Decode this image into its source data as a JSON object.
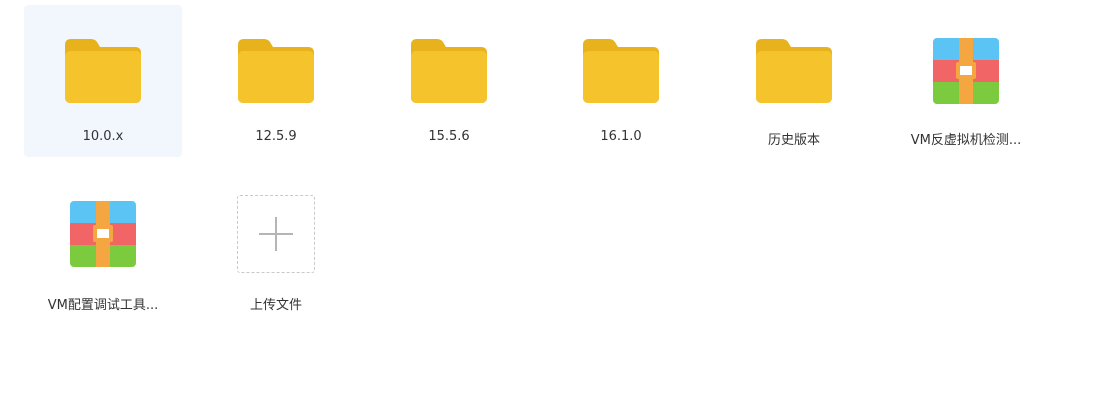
{
  "items": [
    {
      "label": "10.0.x",
      "type": "folder",
      "icon": "folder-icon",
      "selected": true
    },
    {
      "label": "12.5.9",
      "type": "folder",
      "icon": "folder-icon"
    },
    {
      "label": "15.5.6",
      "type": "folder",
      "icon": "folder-icon"
    },
    {
      "label": "16.1.0",
      "type": "folder",
      "icon": "folder-icon"
    },
    {
      "label": "历史版本",
      "type": "folder",
      "icon": "folder-icon"
    },
    {
      "label": "VM反虚拟机检测...",
      "type": "archive",
      "icon": "archive-icon"
    },
    {
      "label": "VM配置调试工具...",
      "type": "archive",
      "icon": "archive-icon"
    }
  ],
  "upload": {
    "label": "上传文件",
    "icon": "plus-icon"
  },
  "colors": {
    "folder": "#f5c42c",
    "folder_tab": "#e8b21d",
    "selected_bg": "#f1f7fd",
    "archive_blue": "#5bc4f5",
    "archive_red": "#f16566",
    "archive_green": "#7ccb3e",
    "archive_strap": "#f4a640"
  }
}
